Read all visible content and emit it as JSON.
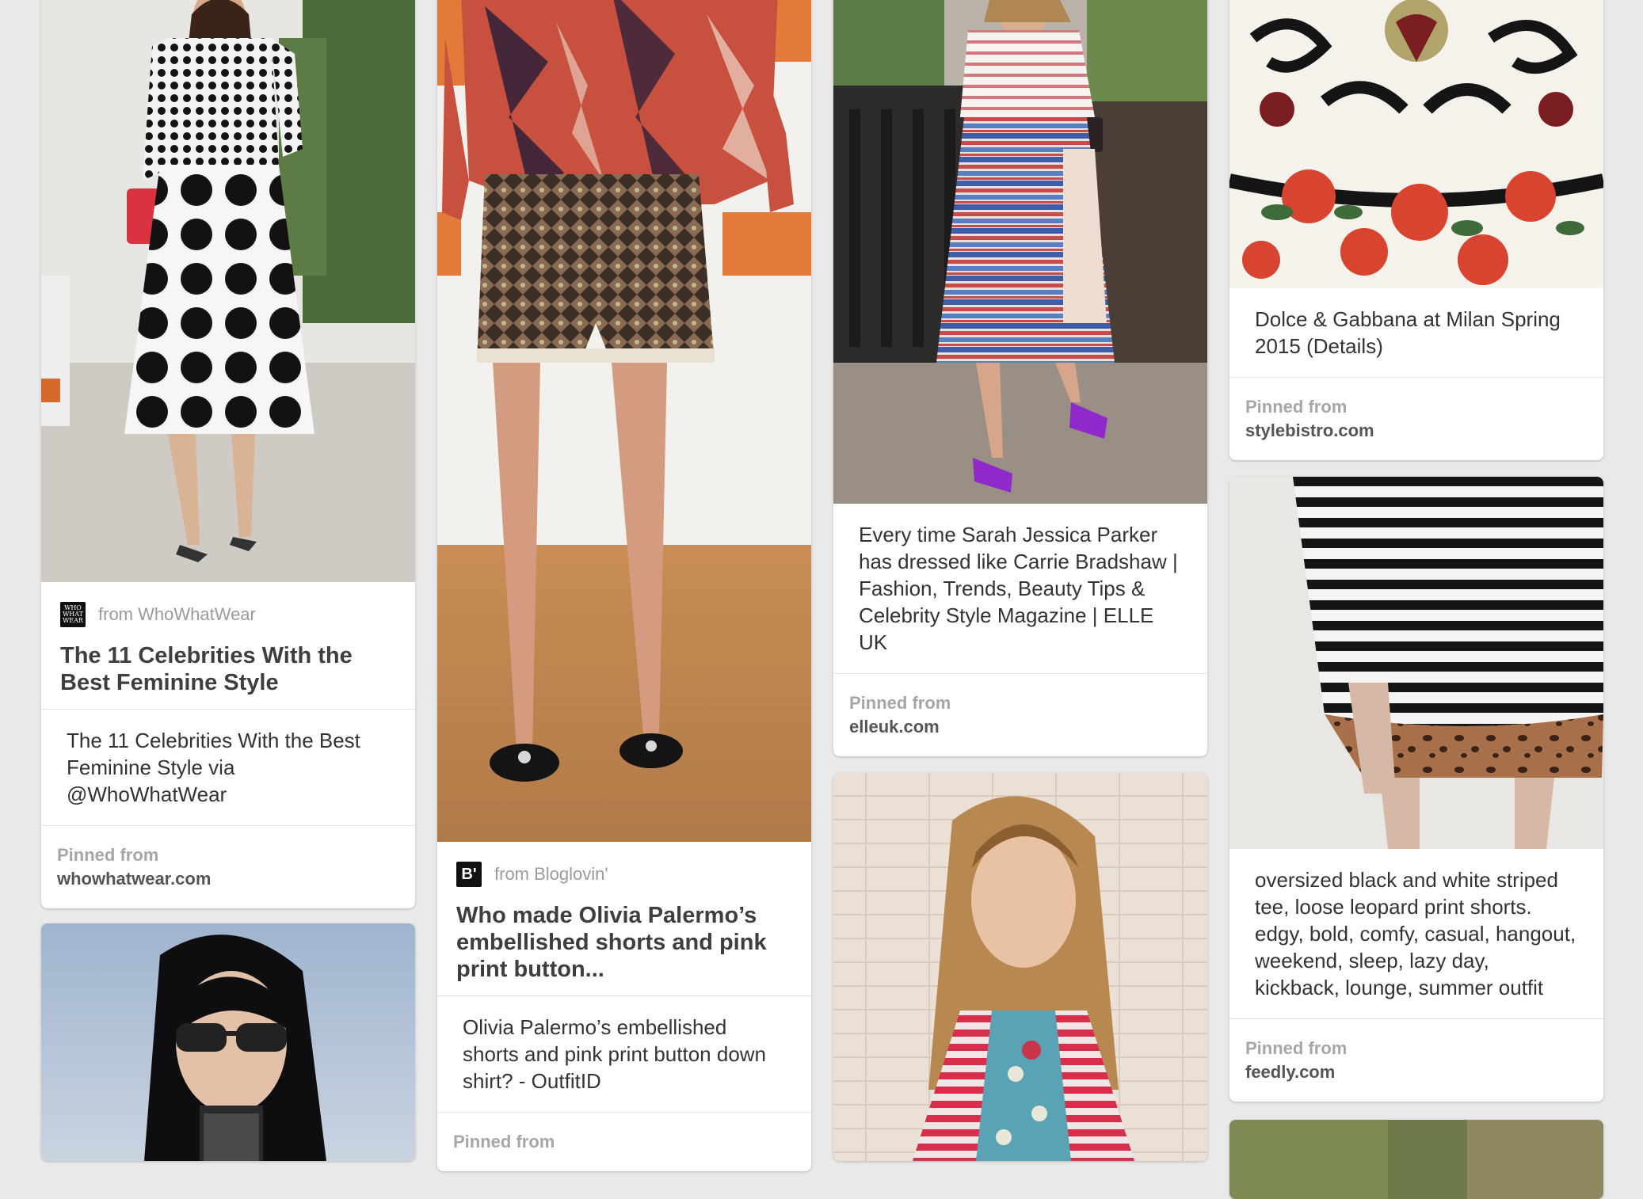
{
  "pins": [
    {
      "image": "woman in polka dot top and big dot skirt",
      "source": "from WhoWhatWear",
      "source_logo": "WHO WHAT WEAR",
      "title": "The 11 Celebrities With the Best Feminine Style",
      "description": "The 11 Celebrities With the Best Feminine Style via @WhoWhatWear",
      "pinned_label": "Pinned from",
      "domain": "whowhatwear.com"
    },
    {
      "image": "woman with dark hair and sunglasses",
      "description": "",
      "pinned_label": "",
      "domain": ""
    },
    {
      "image": "embellished shorts and red print blouse",
      "source": "from Bloglovin'",
      "source_logo": "B'",
      "title": "Who made Olivia Palermo’s embellished shorts and pink print button...",
      "description": "Olivia Palermo’s embellished shorts and pink print button down shirt? - OutfitID",
      "pinned_label": "Pinned from",
      "domain": ""
    },
    {
      "image": "woman in striped top and printed skirt with purple heels",
      "description": "Every time Sarah Jessica Parker has dressed like Carrie Bradshaw | Fashion, Trends, Beauty Tips & Celebrity Style Magazine | ELLE UK",
      "pinned_label": "Pinned from",
      "domain": "elleuk.com"
    },
    {
      "image": "woman in striped red blazer",
      "description": "",
      "pinned_label": "",
      "domain": ""
    },
    {
      "image": "Dolce and Gabbana rose embroidery details",
      "description": "Dolce & Gabbana at Milan Spring 2015 (Details)",
      "pinned_label": "Pinned from",
      "domain": "stylebistro.com"
    },
    {
      "image": "striped tee and leopard shorts",
      "description": "oversized black and white striped tee, loose leopard print shorts. edgy, bold, comfy, casual, hangout, weekend, sleep, lazy day, kickback, lounge, summer outfit",
      "pinned_label": "Pinned from",
      "domain": "feedly.com"
    },
    {
      "image": "outdoor greenery photo",
      "description": "",
      "pinned_label": "",
      "domain": ""
    }
  ]
}
